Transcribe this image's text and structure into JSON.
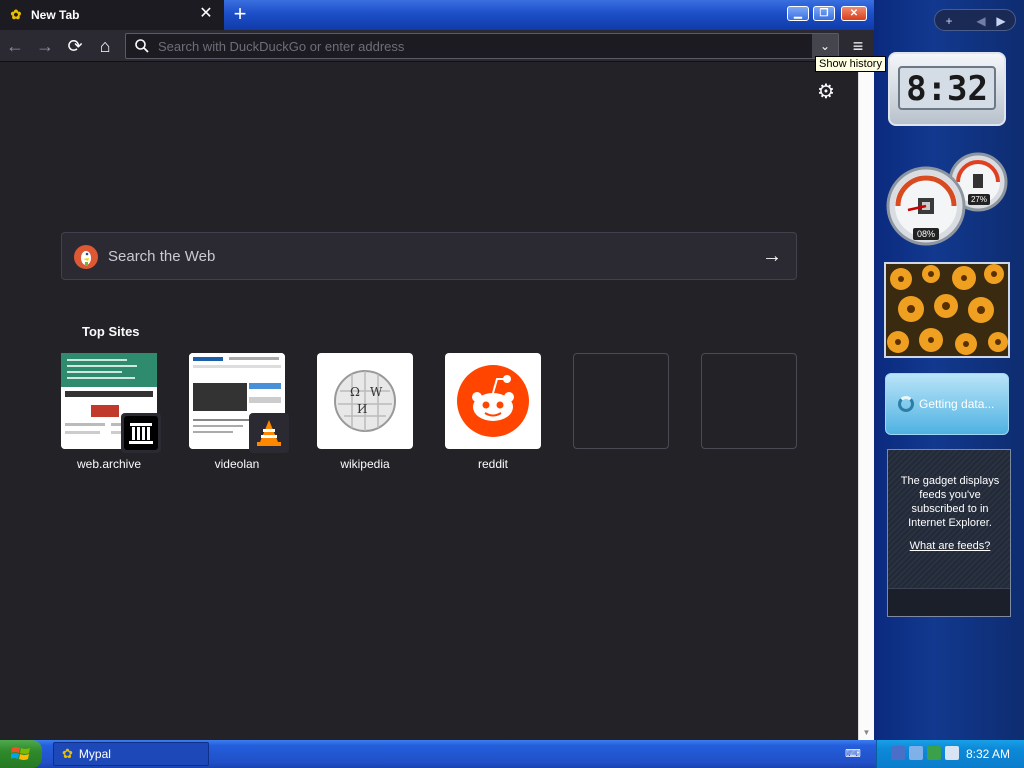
{
  "browser": {
    "tab_title": "New Tab",
    "tab_close": "✕",
    "new_tab": "+",
    "window_controls": {
      "minimize": "▁",
      "maximize": "❐",
      "close": "✕"
    },
    "nav": {
      "back": "←",
      "forward": "→",
      "reload": "⟳",
      "home": "⌂",
      "menu": "≡",
      "dropdown": "⌄"
    },
    "urlbar_placeholder": "Search with DuckDuckGo or enter address",
    "tooltip": "Show history",
    "settings_icon": "⚙"
  },
  "newtab": {
    "search_label": "Search the Web",
    "search_arrow": "→",
    "top_sites_title": "Top Sites",
    "top_sites": [
      {
        "label": "web.archive"
      },
      {
        "label": "videolan"
      },
      {
        "label": "wikipedia"
      },
      {
        "label": "reddit"
      },
      {
        "label": ""
      },
      {
        "label": ""
      }
    ]
  },
  "sidebar": {
    "controls": {
      "add": "+",
      "prev": "◀",
      "next": "▶"
    },
    "clock": "8:32",
    "cpu_percent": "08%",
    "memory_percent": "27%",
    "weather_status": "Getting data...",
    "feeds_text": "The gadget displays feeds you've subscribed to in Internet Explorer.",
    "feeds_link": "What are feeds?"
  },
  "taskbar": {
    "window_label": "Mypal",
    "clock": "8:32 AM"
  },
  "colors": {
    "reddit": "#ff4500",
    "duckduckgo": "#de5833",
    "xp_blue": "#245edb",
    "start_green": "#2f8a2c"
  }
}
